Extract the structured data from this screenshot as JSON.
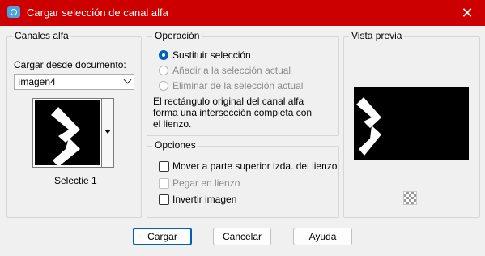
{
  "window": {
    "title": "Cargar selección de canal alfa",
    "close_glyph": "✕"
  },
  "alpha_channels": {
    "title": "Canales alfa",
    "load_from_label": "Cargar desde documento:",
    "document_value": "Imagen4",
    "selection_name": "Selectie 1"
  },
  "operation": {
    "title": "Operación",
    "options": [
      {
        "label": "Sustituir selección",
        "checked": true,
        "enabled": true
      },
      {
        "label": "Añadir a la selección actual",
        "checked": false,
        "enabled": false
      },
      {
        "label": "Eliminar de la selección actual",
        "checked": false,
        "enabled": false
      }
    ],
    "description_lines": [
      "El rectángulo original del canal alfa",
      "forma una intersección completa con",
      "el lienzo."
    ]
  },
  "options": {
    "title": "Opciones",
    "items": [
      {
        "label": "Mover a parte superior izda. del lienzo",
        "checked": false,
        "enabled": true
      },
      {
        "label": "Pegar en lienzo",
        "checked": false,
        "enabled": false
      },
      {
        "label": "Invertir imagen",
        "checked": false,
        "enabled": true
      }
    ]
  },
  "preview": {
    "title": "Vista previa"
  },
  "buttons": {
    "ok": "Cargar",
    "cancel": "Cancelar",
    "help": "Ayuda"
  },
  "colors": {
    "titlebar": "#cc0000",
    "accent": "#005fb8"
  }
}
